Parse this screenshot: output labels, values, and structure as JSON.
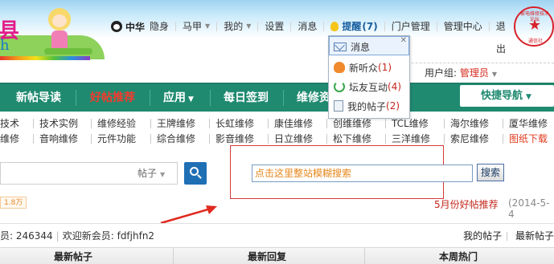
{
  "header": {
    "logo_fragment_top": "县",
    "logo_fragment_bottom": "h",
    "user_name": "中华",
    "top_links": [
      {
        "label": "隐身"
      },
      {
        "label": "马甲",
        "dropdown": true
      },
      {
        "label": "我的",
        "dropdown": true
      },
      {
        "label": "设置"
      },
      {
        "label": "消息"
      }
    ],
    "remind_label": "提醒",
    "remind_count": "(7)",
    "right_links": [
      {
        "label": "门户管理"
      },
      {
        "label": "管理中心"
      },
      {
        "label": "退"
      }
    ],
    "logout_tail": "出",
    "usergroup_label": "用户组:",
    "usergroup_value": "管理员"
  },
  "seal": {
    "text_top": "家电维修技术论坛",
    "text_bottom": "通信社",
    "star": "★"
  },
  "reminder_popup": {
    "items": [
      {
        "label": "消息",
        "count": "",
        "icon": "mail-icon"
      },
      {
        "label": "新听众",
        "count": "(1)",
        "icon": "person-icon"
      },
      {
        "label": "坛友互动",
        "count": "(4)",
        "icon": "recycle-icon"
      },
      {
        "label": "我的帖子",
        "count": "(2)",
        "icon": "document-icon"
      }
    ],
    "close": "✕"
  },
  "main_nav": {
    "items": [
      {
        "label": "新帖导读"
      },
      {
        "label": "好帖推荐",
        "highlight": true
      },
      {
        "label": "应用",
        "dropdown": true
      },
      {
        "label": "每日签到"
      },
      {
        "label": "维修资"
      }
    ],
    "quick_nav": "快捷导航"
  },
  "category_links": {
    "row1": [
      "技术",
      "技术实例",
      "维修经验",
      "王牌维修",
      "长虹维修",
      "康佳维修",
      "创维维修",
      "TCL维修",
      "海尔维修",
      "厦华维修"
    ],
    "row2": [
      "维修",
      "音响维修",
      "元件功能",
      "综合维修",
      "影音维修",
      "日立维修",
      "松下维修",
      "三洋维修",
      "索尼维修",
      "图纸下载"
    ]
  },
  "search": {
    "type_label": "帖子",
    "fuzzy_placeholder": "点击这里整站模糊搜索",
    "fuzzy_button": "搜索"
  },
  "stats": {
    "badge": "1.8万",
    "month_recommend": "5月份好帖推荐",
    "date": "(2014-5-4",
    "member_text": "员: 246344",
    "welcome_text": "欢迎新会员:",
    "new_member": "fdfjhfn2",
    "links": [
      "我的帖子",
      "最新帖子"
    ]
  },
  "tabs": [
    "最新帖子",
    "最新回复",
    "本周热门"
  ],
  "colors": {
    "nav_green": "#1f8a70",
    "accent_red": "#c4271c",
    "annotation_red": "#d53b3b"
  }
}
